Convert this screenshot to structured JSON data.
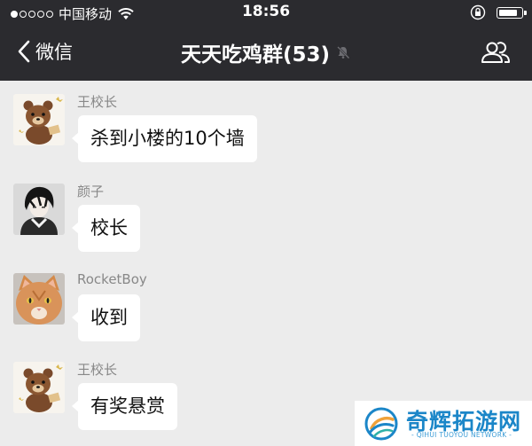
{
  "status_bar": {
    "carrier": "中国移动",
    "time": "18:56",
    "signal_strength": "1 of 5 dots filled",
    "icons": [
      "signal-dots-icon",
      "wifi-icon",
      "orientation-lock-icon",
      "battery-icon"
    ],
    "battery_level": 0.85
  },
  "nav": {
    "back_label": "微信",
    "title": "天天吃鸡群(53)",
    "icons": [
      "back-chevron-icon",
      "mute-bell-icon",
      "group-members-icon"
    ]
  },
  "messages": [
    {
      "sender": "王校长",
      "text": "杀到小楼的10个墙",
      "avatar": "brown-bear-avatar"
    },
    {
      "sender": "颜子",
      "text": "校长",
      "avatar": "anime-boy-avatar"
    },
    {
      "sender": "RocketBoy",
      "text": "收到",
      "avatar": "orange-cat-avatar"
    },
    {
      "sender": "王校长",
      "text": "有奖悬赏",
      "avatar": "brown-bear-avatar"
    }
  ],
  "watermark": {
    "brand": "奇辉拓游网",
    "subtitle": "- QIHUI TUOYOU NETWORK -"
  },
  "colors": {
    "bar_bg": "#2b2b2f",
    "chat_bg": "#ececec",
    "bubble_bg": "#ffffff",
    "sender_text": "#888888",
    "watermark_blue": "#1b86c8"
  }
}
